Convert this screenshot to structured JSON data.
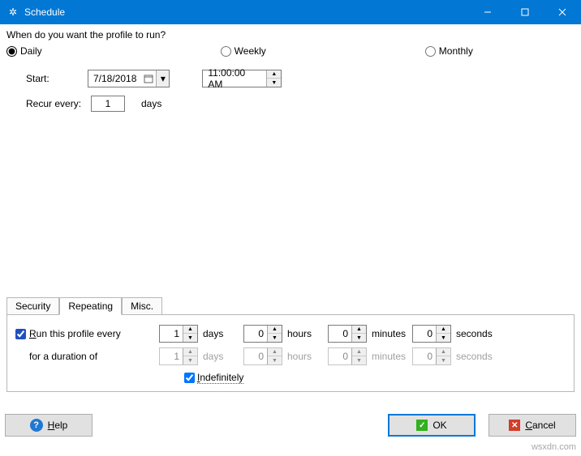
{
  "window": {
    "title": "Schedule"
  },
  "question": "When do you want the profile to run?",
  "period": {
    "daily": "Daily",
    "weekly": "Weekly",
    "monthly": "Monthly",
    "selected": "daily"
  },
  "start": {
    "label": "Start:",
    "date": "7/18/2018",
    "time": "11:00:00 AM"
  },
  "recur": {
    "label": "Recur every:",
    "value": "1",
    "unit": "days"
  },
  "tabs": {
    "security": "Security",
    "repeating": "Repeating",
    "misc": "Misc.",
    "active": "repeating"
  },
  "repeating": {
    "run_label": "Run this profile every",
    "duration_label": "for a duration of",
    "indefinitely": "Indefinitely",
    "every": {
      "days": "1",
      "hours": "0",
      "minutes": "0",
      "seconds": "0"
    },
    "duration": {
      "days": "1",
      "hours": "0",
      "minutes": "0",
      "seconds": "0"
    },
    "units": {
      "days": "days",
      "hours": "hours",
      "minutes": "minutes",
      "seconds": "seconds"
    }
  },
  "buttons": {
    "help": "Help",
    "ok": "OK",
    "cancel": "Cancel"
  },
  "watermark": "wsxdn.com"
}
